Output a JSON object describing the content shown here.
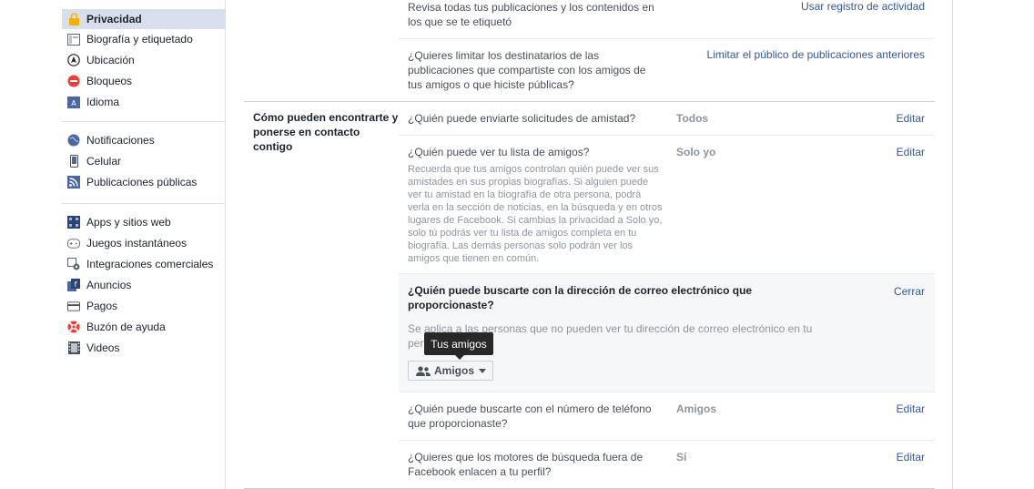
{
  "sidebar": {
    "group1": [
      {
        "label": "Privacidad",
        "icon": "lock-icon",
        "active": true
      },
      {
        "label": "Biografía y etiquetado",
        "icon": "timeline-icon"
      },
      {
        "label": "Ubicación",
        "icon": "location-icon"
      },
      {
        "label": "Bloqueos",
        "icon": "block-icon"
      },
      {
        "label": "Idioma",
        "icon": "language-icon"
      }
    ],
    "group2": [
      {
        "label": "Notificaciones",
        "icon": "globe-icon"
      },
      {
        "label": "Celular",
        "icon": "mobile-icon"
      },
      {
        "label": "Publicaciones públicas",
        "icon": "rss-icon"
      }
    ],
    "group3": [
      {
        "label": "Apps y sitios web",
        "icon": "apps-icon"
      },
      {
        "label": "Juegos instantáneos",
        "icon": "gamepad-icon"
      },
      {
        "label": "Integraciones comerciales",
        "icon": "business-integrations-icon"
      },
      {
        "label": "Anuncios",
        "icon": "ads-icon"
      },
      {
        "label": "Pagos",
        "icon": "payments-icon"
      },
      {
        "label": "Buzón de ayuda",
        "icon": "lifebuoy-icon"
      },
      {
        "label": "Videos",
        "icon": "film-icon"
      }
    ]
  },
  "top_rows": [
    {
      "question": "Revisa todas tus publicaciones y los contenidos en los que se te etiquetó",
      "action": "Usar registro de actividad"
    },
    {
      "question": "¿Quieres limitar los destinatarios de las publicaciones que compartiste con los amigos de tus amigos o que hiciste públicas?",
      "action": "Limitar el público de publicaciones anteriores"
    }
  ],
  "section": {
    "title": "Cómo pueden encontrarte y ponerse en contacto contigo",
    "rows": [
      {
        "question": "¿Quién puede enviarte solicitudes de amistad?",
        "value": "Todos",
        "action": "Editar"
      },
      {
        "question": "¿Quién puede ver tu lista de amigos?",
        "value": "Solo yo",
        "action": "Editar",
        "description": "Recuerda que tus amigos controlan quién puede ver sus amistades en sus propias biografías. Si alguien puede ver tu amistad en la biografía de otra persona, podrá verla en la sección de noticias, en la búsqueda y en otros lugares de Facebook. Si cambias la privacidad a Solo yo, solo tú podrás ver tu lista de amigos completa en tu biografía. Las demás personas solo podrán ver los amigos que tienen en común."
      },
      {
        "question": "¿Quién puede buscarte con el número de teléfono que proporcionaste?",
        "value": "Amigos",
        "action": "Editar"
      },
      {
        "question": "¿Quieres que los motores de búsqueda fuera de Facebook enlacen a tu perfil?",
        "value": "Sí",
        "action": "Editar"
      }
    ],
    "expanded": {
      "question": "¿Quién puede buscarte con la dirección de correo electrónico que proporcionaste?",
      "description": "Se aplica a las personas que no pueden ver tu dirección de correo electrónico en tu perfil.",
      "action": "Cerrar",
      "dropdown_label": "Amigos",
      "tooltip": "Tus amigos"
    }
  },
  "colors": {
    "link": "#365899",
    "active_bg": "#d8dfea",
    "muted": "#90949c"
  }
}
